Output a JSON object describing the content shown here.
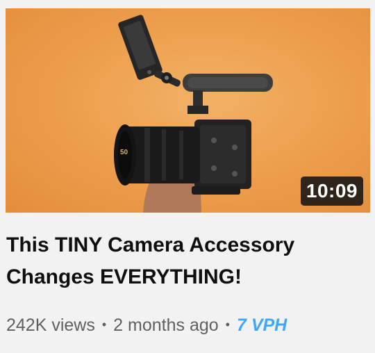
{
  "video": {
    "thumbnail_icon": "camera-rig-thumbnail",
    "lens_marking": "50",
    "duration": "10:09",
    "title_line1": "This TINY Camera Accessory",
    "title_line2": "Changes EVERYTHING!",
    "views": "242K views",
    "separator": "•",
    "age": "2 months ago",
    "vph": "7 VPH"
  },
  "colors": {
    "background": "#f2f2f2",
    "thumbnail_bg": "#eea04f",
    "title": "#0f0f0f",
    "meta": "#606060",
    "vph": "#3ea6ff"
  }
}
